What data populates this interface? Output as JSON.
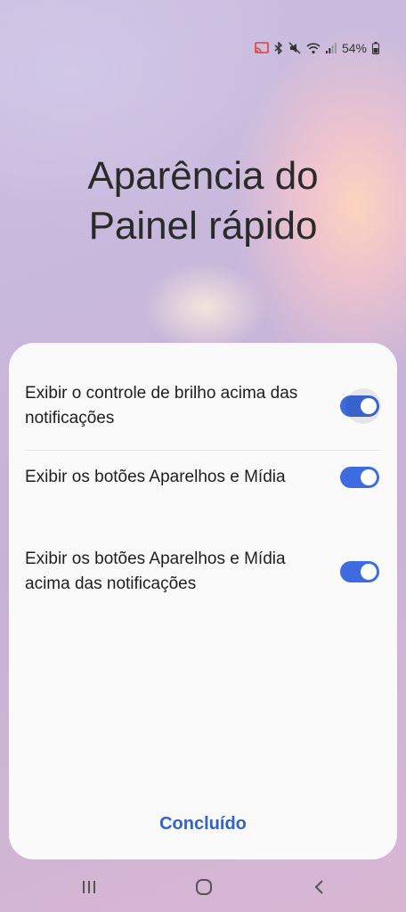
{
  "status_bar": {
    "battery_percent": "54%",
    "icons": [
      "cast-icon",
      "bluetooth-icon",
      "mute-icon",
      "wifi-icon",
      "signal-icon",
      "battery-icon"
    ]
  },
  "title": {
    "line1": "Aparência do",
    "line2": "Painel rápido"
  },
  "options": [
    {
      "label": "Exibir o controle de brilho acima das notificações",
      "enabled": true
    },
    {
      "label": "Exibir os botões Aparelhos e Mídia",
      "enabled": true
    },
    {
      "label": "Exibir os botões Aparelhos e Mídia acima das notificações",
      "enabled": true
    }
  ],
  "done_label": "Concluído",
  "nav": [
    "recents-icon",
    "home-icon",
    "back-icon"
  ],
  "colors": {
    "accent": "#3e6bdf",
    "done_text": "#3463c6"
  }
}
